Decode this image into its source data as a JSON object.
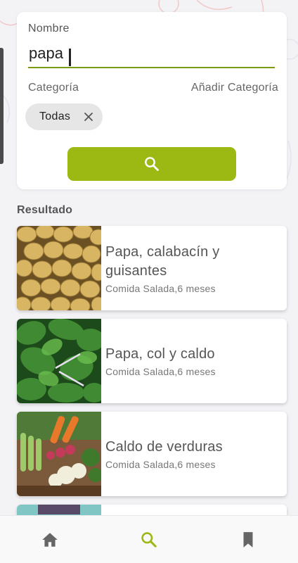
{
  "search": {
    "name_label": "Nombre",
    "name_value": "papa",
    "category_label": "Categoría",
    "add_category_label": "Añadir Categoría",
    "selected_category": "Todas",
    "search_button_icon": "search-icon"
  },
  "results": {
    "heading": "Resultado",
    "items": [
      {
        "title": "Papa, calabacín y guisantes",
        "subtitle": "Comida Salada,6 meses",
        "image": "potatoes"
      },
      {
        "title": "Papa, col y caldo",
        "subtitle": "Comida Salada,6 meses",
        "image": "leafy-greens"
      },
      {
        "title": "Caldo de verduras",
        "subtitle": "Comida Salada,6 meses",
        "image": "mixed-vegetables"
      },
      {
        "title": "",
        "subtitle": "",
        "image": "partial"
      }
    ]
  },
  "nav": {
    "items": [
      {
        "icon": "home-icon",
        "active": false
      },
      {
        "icon": "search-icon",
        "active": true
      },
      {
        "icon": "bookmark-icon",
        "active": false
      }
    ]
  },
  "colors": {
    "accent": "#9bb813",
    "accent_dark": "#7a9a0f",
    "inactive_icon": "#666666",
    "background": "#f3f3f6"
  }
}
